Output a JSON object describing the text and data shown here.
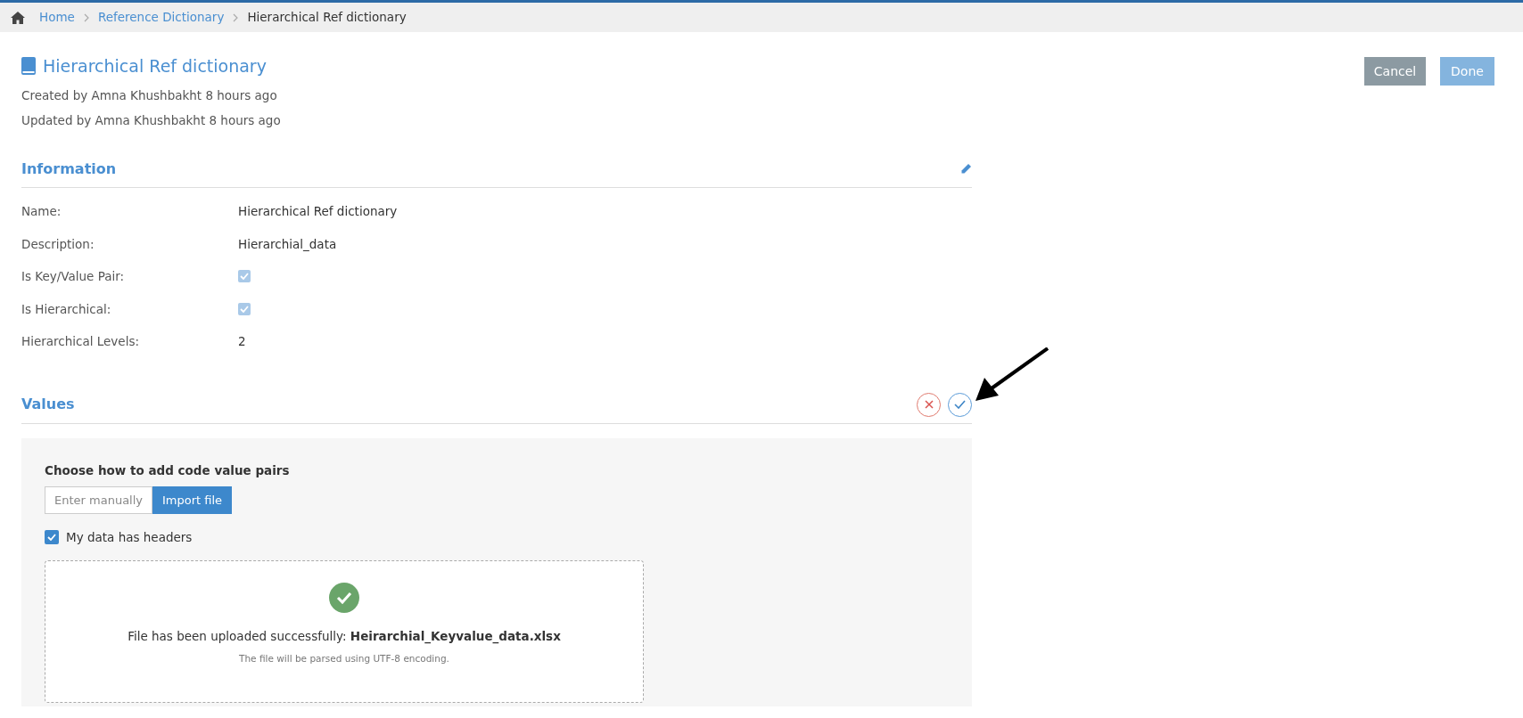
{
  "breadcrumb": [
    {
      "label": "Home",
      "link": true
    },
    {
      "label": "Reference Dictionary",
      "link": true
    },
    {
      "label": "Hierarchical Ref dictionary",
      "link": false
    }
  ],
  "header": {
    "title": "Hierarchical Ref dictionary",
    "created": "Created by Amna Khushbakht 8 hours ago",
    "updated": "Updated by Amna Khushbakht 8 hours ago"
  },
  "actions": [
    {
      "label": "Cancel",
      "kind": "secondary"
    },
    {
      "label": "Done",
      "kind": "primary"
    }
  ],
  "information": {
    "title": "Information",
    "fields": [
      {
        "label": "Name:",
        "kind": "text",
        "value": "Hierarchical Ref dictionary"
      },
      {
        "label": "Description:",
        "kind": "text",
        "value": "Hierarchial_data"
      },
      {
        "label": "Is Key/Value Pair:",
        "kind": "checkbox",
        "checked": true
      },
      {
        "label": "Is Hierarchical:",
        "kind": "checkbox",
        "checked": true
      },
      {
        "label": "Hierarchical Levels:",
        "kind": "text",
        "value": "2"
      }
    ]
  },
  "values": {
    "title": "Values",
    "prompt": "Choose how to add code value pairs",
    "modes": [
      {
        "label": "Enter manually",
        "selected": false
      },
      {
        "label": "Import file",
        "selected": true
      }
    ],
    "headers_option": {
      "label": "My data has headers",
      "checked": true
    },
    "upload": {
      "message": "File has been uploaded successfully: **Heirarchial_Keyvalue_data.xlsx**",
      "note": "The file will be parsed using UTF-8 encoding."
    }
  }
}
